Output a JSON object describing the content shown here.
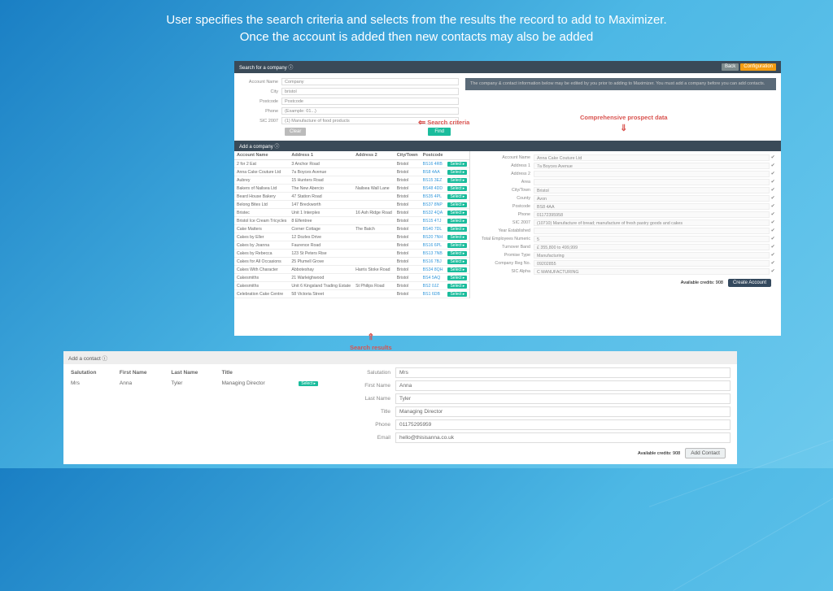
{
  "slide": {
    "line1": "User specifies the search criteria and selects from the results the record to add to Maximizer.",
    "line2": "Once the account is added then new contacts may also be added"
  },
  "header": {
    "search_title": "Search for a company ⓘ",
    "back": "Back",
    "config": "Configuration"
  },
  "notice": "The company & contact information below may be edited by you prior to adding to Maximizer. You must add a company before you can add contacts.",
  "search_form": {
    "labels": [
      "Account Name",
      "City",
      "Postcode",
      "Phone",
      "SIC 2007"
    ],
    "values": [
      "Company",
      "bristol",
      "Postcode",
      "(Example: 01...)",
      "(1) Manufacture of food products"
    ],
    "clear": "Clear",
    "find": "Find"
  },
  "annotations": {
    "search": "Search criteria",
    "data": "Comprehensive prospect data",
    "results": "Search results"
  },
  "results": {
    "title": "Add a company ⓘ",
    "headers": [
      "Account Name",
      "Address 1",
      "Address 2",
      "City/Town",
      "Postcode",
      ""
    ],
    "rows": [
      [
        "2 for 2 Eat",
        "3 Anchor Road",
        "",
        "Bristol",
        "BS16 4RB"
      ],
      [
        "Anna Cake Couture Ltd",
        "7a Boyces Avenue",
        "",
        "Bristol",
        "BS8 4AA"
      ],
      [
        "Aubrey",
        "15 Hunters Road",
        "",
        "Bristol",
        "BS15 3EZ"
      ],
      [
        "Bakers of Nailsea Ltd",
        "The New Abercio",
        "Nailsea Wall Lane",
        "Bristol",
        "BS48 4DD"
      ],
      [
        "Beard House Bakery",
        "47 Station Road",
        "",
        "Bristol",
        "BS35 4PL"
      ],
      [
        "Belong Bites Ltd",
        "147 Breckworth",
        "",
        "Bristol",
        "BS37 8NP"
      ],
      [
        "Bristec",
        "Unit 1 Interplex",
        "16 Ash Ridge Road",
        "Bristol",
        "BS32 4QA"
      ],
      [
        "Bristol Ice Cream Tricycles",
        "8 Elfentree",
        "",
        "Bristol",
        "BS15 4TJ"
      ],
      [
        "Cake Matters",
        "Corner Cottage",
        "The Batch",
        "Bristol",
        "BS40 7DL"
      ],
      [
        "Cakes by Eller",
        "12 Dozles Drive",
        "",
        "Bristol",
        "BS20 7NH"
      ],
      [
        "Cakes by Joanna",
        "Faurence Road",
        "",
        "Bristol",
        "BS16 6PL"
      ],
      [
        "Cakes by Rebecca",
        "123 St Peters Rise",
        "",
        "Bristol",
        "BS13 7NB"
      ],
      [
        "Cakes for All Occasions",
        "25 Plumell Grove",
        "",
        "Bristol",
        "BS16 7BJ"
      ],
      [
        "Cakes With Character",
        "Abboteshay",
        "Harris Stoke Road",
        "Bristol",
        "BS34 8QH"
      ],
      [
        "Cakesmiths",
        "21 Warleighwood",
        "",
        "Bristol",
        "BS4 5AQ"
      ],
      [
        "Cakesmiths",
        "Unit 6 Kingsland Trading Estate",
        "St Philips Road",
        "Bristol",
        "BS2 0JZ"
      ],
      [
        "Celebration Cake Centre",
        "58 Victoria Street",
        "",
        "Bristol",
        "BS1 6DB"
      ]
    ],
    "select": "Select ▸"
  },
  "details": {
    "fields": [
      [
        "Account Name",
        "Anna Cake Couture Ltd"
      ],
      [
        "Address 1",
        "7a Boyces Avenue"
      ],
      [
        "Address 2",
        ""
      ],
      [
        "Area",
        ""
      ],
      [
        "City/Town",
        "Bristol"
      ],
      [
        "County",
        "Avon"
      ],
      [
        "Postcode",
        "BS8 4AA"
      ],
      [
        "Phone",
        "01172395958"
      ],
      [
        "SIC 2007",
        "(10710) Manufacture of bread; manufacture of fresh pastry goods and cakes"
      ],
      [
        "Year Established",
        ""
      ],
      [
        "Total Employees Numeric",
        "5"
      ],
      [
        "Turnover Band",
        "£ 355,800 to 499,999"
      ],
      [
        "Promise Type",
        "Manufacturing"
      ],
      [
        "Company Reg No.",
        "09202855"
      ],
      [
        "SIC Alpha",
        "C MANUFACTURING"
      ]
    ],
    "credits_label": "Available credits: 908",
    "create": "Create Account"
  },
  "contact": {
    "title": "Add a contact ⓘ",
    "headers": [
      "Salutation",
      "First Name",
      "Last Name",
      "Title"
    ],
    "row": [
      "Mrs",
      "Anna",
      "Tyler",
      "Managing Director"
    ],
    "select": "Select ▸",
    "form": [
      [
        "Salutation",
        "Mrs"
      ],
      [
        "First Name",
        "Anna"
      ],
      [
        "Last Name",
        "Tyler"
      ],
      [
        "Title",
        "Managing Director"
      ],
      [
        "Phone",
        "01175295959"
      ],
      [
        "Email",
        "hello@thisisanna.co.uk"
      ]
    ],
    "credits_label": "Available credits: 908",
    "add": "Add Contact"
  }
}
